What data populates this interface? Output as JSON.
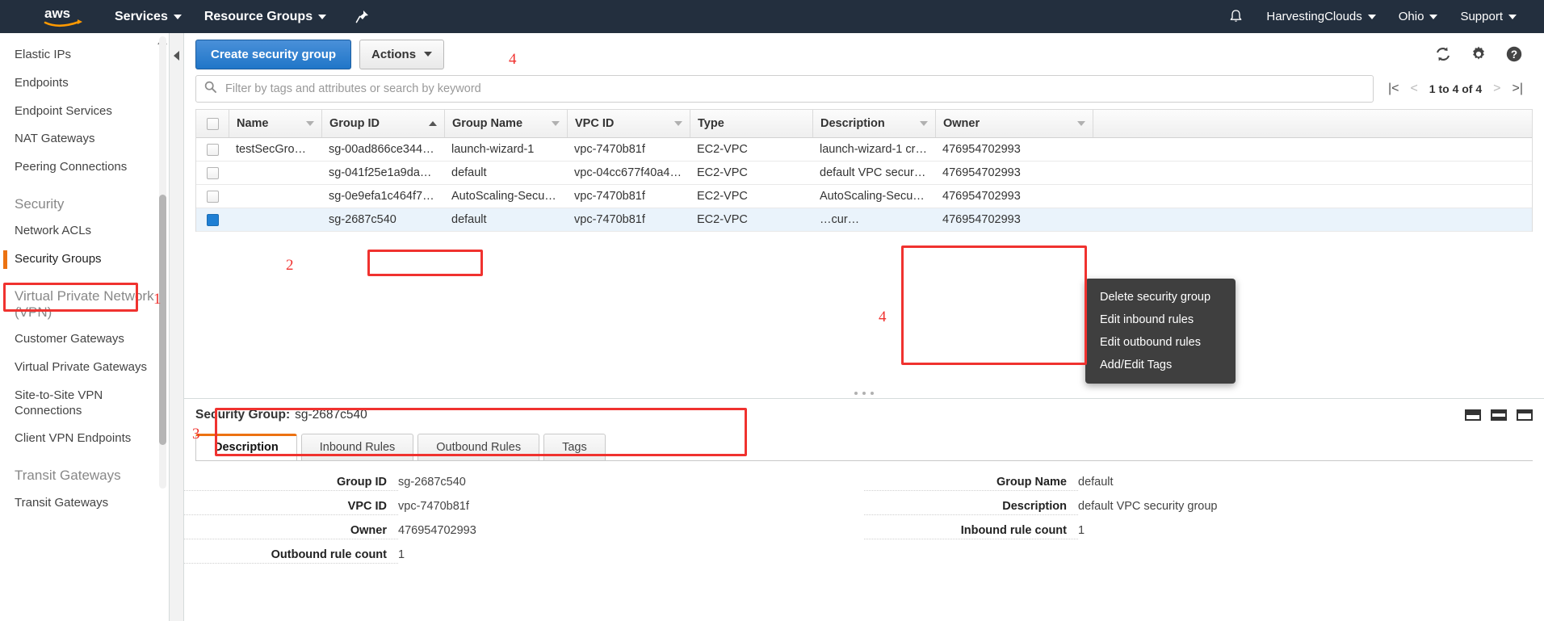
{
  "topnav": {
    "logo_alt": "aws",
    "services_label": "Services",
    "resource_groups_label": "Resource Groups",
    "pin_icon": "pin-icon",
    "bell_icon": "bell-icon",
    "account_label": "HarvestingClouds",
    "region_label": "Ohio",
    "support_label": "Support"
  },
  "sidebar": {
    "items": [
      {
        "label": "Elastic IPs",
        "type": "link",
        "active": false
      },
      {
        "label": "Endpoints",
        "type": "link",
        "active": false
      },
      {
        "label": "Endpoint Services",
        "type": "link",
        "active": false
      },
      {
        "label": "NAT Gateways",
        "type": "link",
        "active": false
      },
      {
        "label": "Peering Connections",
        "type": "link",
        "active": false
      },
      {
        "label": "Security",
        "type": "head",
        "active": false
      },
      {
        "label": "Network ACLs",
        "type": "link",
        "active": false
      },
      {
        "label": "Security Groups",
        "type": "link",
        "active": true
      },
      {
        "label": "Virtual Private Network (VPN)",
        "type": "head",
        "active": false
      },
      {
        "label": "Customer Gateways",
        "type": "link",
        "active": false
      },
      {
        "label": "Virtual Private Gateways",
        "type": "link",
        "active": false
      },
      {
        "label": "Site-to-Site VPN Connections",
        "type": "link",
        "active": false
      },
      {
        "label": "Client VPN Endpoints",
        "type": "link",
        "active": false
      },
      {
        "label": "Transit Gateways",
        "type": "head",
        "active": false
      },
      {
        "label": "Transit Gateways",
        "type": "link",
        "active": false
      }
    ]
  },
  "toolbar": {
    "create_label": "Create security group",
    "actions_label": "Actions",
    "refresh_icon": "refresh-icon",
    "settings_icon": "gear-icon",
    "help_icon": "help-icon"
  },
  "search": {
    "placeholder": "Filter by tags and attributes or search by keyword",
    "value": "",
    "icon": "search-icon"
  },
  "pagination": {
    "range_label": "1 to 4 of 4",
    "first_icon": "page-first-icon",
    "prev_icon": "page-prev-icon",
    "next_icon": "page-next-icon",
    "last_icon": "page-last-icon"
  },
  "table": {
    "columns": [
      {
        "key": "name",
        "label": "Name",
        "sort": "none"
      },
      {
        "key": "gid",
        "label": "Group ID",
        "sort": "asc"
      },
      {
        "key": "gname",
        "label": "Group Name",
        "sort": "none"
      },
      {
        "key": "vpc",
        "label": "VPC ID",
        "sort": "none"
      },
      {
        "key": "type",
        "label": "Type",
        "sort": "none"
      },
      {
        "key": "desc",
        "label": "Description",
        "sort": "none"
      },
      {
        "key": "owner",
        "label": "Owner",
        "sort": "none"
      }
    ],
    "rows": [
      {
        "selected": false,
        "name": "testSecGro…",
        "gid": "sg-00ad866ce344…",
        "gname": "launch-wizard-1",
        "vpc": "vpc-7470b81f",
        "type": "EC2-VPC",
        "desc": "launch-wizard-1 cr…",
        "owner": "476954702993"
      },
      {
        "selected": false,
        "name": "",
        "gid": "sg-041f25e1a9da…",
        "gname": "default",
        "vpc": "vpc-04cc677f40a4…",
        "type": "EC2-VPC",
        "desc": "default VPC secur…",
        "owner": "476954702993"
      },
      {
        "selected": false,
        "name": "",
        "gid": "sg-0e9efa1c464f7…",
        "gname": "AutoScaling-Secur…",
        "vpc": "vpc-7470b81f",
        "type": "EC2-VPC",
        "desc": "AutoScaling-Secu…",
        "owner": "476954702993"
      },
      {
        "selected": true,
        "name": "",
        "gid": "sg-2687c540",
        "gname": "default",
        "vpc": "vpc-7470b81f",
        "type": "EC2-VPC",
        "desc": "…cur…",
        "owner": "476954702993"
      }
    ]
  },
  "context_menu": {
    "items": [
      {
        "label": "Delete security group"
      },
      {
        "label": "Edit inbound rules"
      },
      {
        "label": "Edit outbound rules"
      },
      {
        "label": "Add/Edit Tags"
      }
    ]
  },
  "detail": {
    "heading_label": "Security Group:",
    "heading_value": "sg-2687c540",
    "tabs": [
      {
        "label": "Description",
        "active": true
      },
      {
        "label": "Inbound Rules",
        "active": false
      },
      {
        "label": "Outbound Rules",
        "active": false
      },
      {
        "label": "Tags",
        "active": false
      }
    ],
    "left_fields": [
      {
        "label": "Group ID",
        "value": "sg-2687c540"
      },
      {
        "label": "VPC ID",
        "value": "vpc-7470b81f"
      },
      {
        "label": "Owner",
        "value": "476954702993"
      },
      {
        "label": "Outbound rule count",
        "value": "1"
      }
    ],
    "right_fields": [
      {
        "label": "Group Name",
        "value": "default"
      },
      {
        "label": "Description",
        "value": "default VPC security group"
      },
      {
        "label": "Inbound rule count",
        "value": "1"
      }
    ],
    "panel_icons": [
      "panel-bottom-icon",
      "panel-split-icon",
      "panel-right-icon"
    ]
  },
  "annotations": [
    {
      "number": "1"
    },
    {
      "number": "2"
    },
    {
      "number": "3"
    },
    {
      "number": "4"
    },
    {
      "number": "4"
    }
  ],
  "colors": {
    "nav_bg": "#232f3e",
    "accent_orange": "#ec7211",
    "primary_blue": "#2076c8",
    "annotation_red": "#f0322f",
    "selected_row": "#eaf3fb"
  }
}
